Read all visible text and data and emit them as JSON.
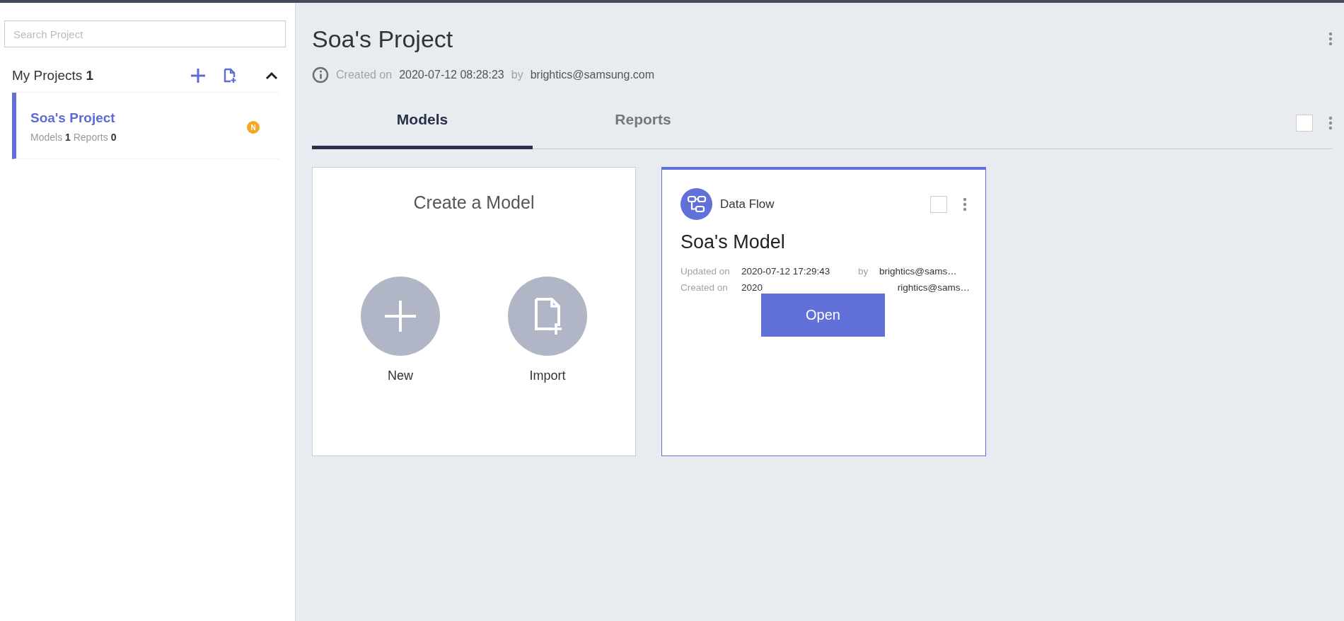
{
  "sidebar": {
    "search": {
      "placeholder": "Search Project"
    },
    "section": {
      "title": "My Projects",
      "count": "1",
      "expanded": true
    },
    "projects": [
      {
        "name": "Soa's Project",
        "selected": true,
        "badge": "N",
        "stats": [
          {
            "label": "Models",
            "value": "1"
          },
          {
            "label": "Reports",
            "value": "0"
          }
        ]
      }
    ]
  },
  "project": {
    "title": "Soa's Project",
    "created_label": "Created on",
    "created": "2020-07-12 08:28:23",
    "by_label": "by",
    "author": "brightics@samsung.com"
  },
  "tabs": [
    {
      "label": "Models",
      "selected": true
    },
    {
      "label": "Reports",
      "selected": false
    }
  ],
  "select_all": {
    "checked": false
  },
  "create_card": {
    "title": "Create a Model",
    "actions": [
      {
        "kind": "new",
        "label": "New"
      },
      {
        "kind": "import",
        "label": "Import"
      }
    ]
  },
  "models": [
    {
      "type": "Data Flow",
      "name": "Soa's Model",
      "checked": false,
      "hovered": true,
      "open_label": "Open",
      "meta": [
        {
          "label": "Updated on",
          "date": "2020-07-12 17:29:43",
          "by_label": "by",
          "by": "brightics@sams…"
        },
        {
          "label": "Created on",
          "date": "2020",
          "by": "rightics@sams…"
        }
      ]
    }
  ]
}
